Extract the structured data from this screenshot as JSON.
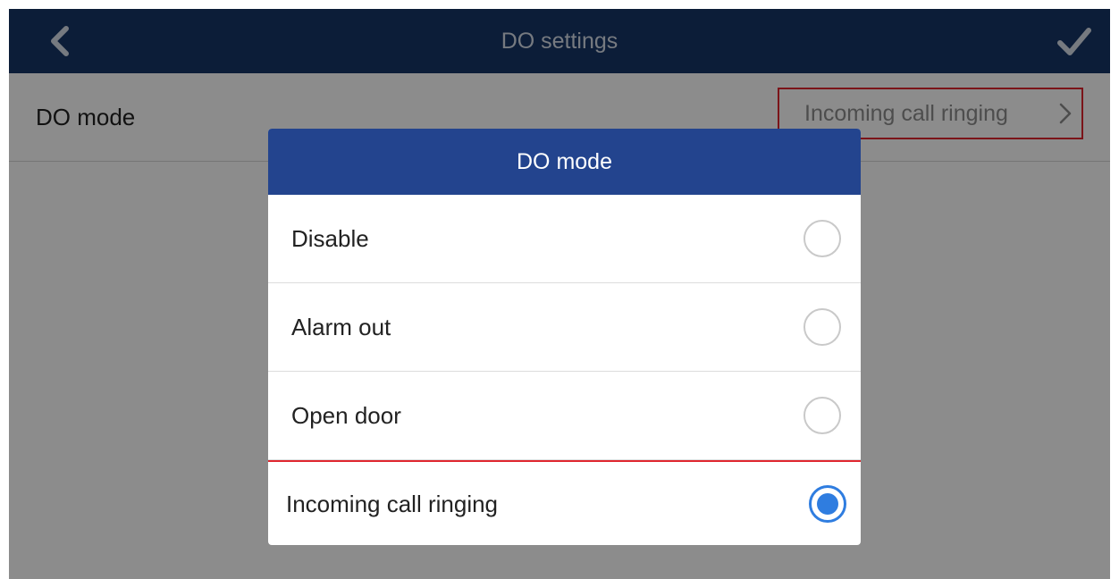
{
  "header": {
    "title": "DO settings",
    "back_icon": "chevron-left-icon",
    "confirm_icon": "checkmark-icon"
  },
  "setting_row": {
    "label": "DO mode",
    "value": "Incoming call ringing",
    "chevron_icon": "chevron-right-icon"
  },
  "dialog": {
    "title": "DO mode",
    "options": [
      {
        "label": "Disable",
        "selected": false
      },
      {
        "label": "Alarm out",
        "selected": false
      },
      {
        "label": "Open door",
        "selected": false
      },
      {
        "label": "Incoming call ringing",
        "selected": true
      }
    ]
  },
  "colors": {
    "titlebar": "#163566",
    "dialog_header": "#23448e",
    "radio_selected": "#2f7de0",
    "highlight_outline": "#e0262f"
  }
}
